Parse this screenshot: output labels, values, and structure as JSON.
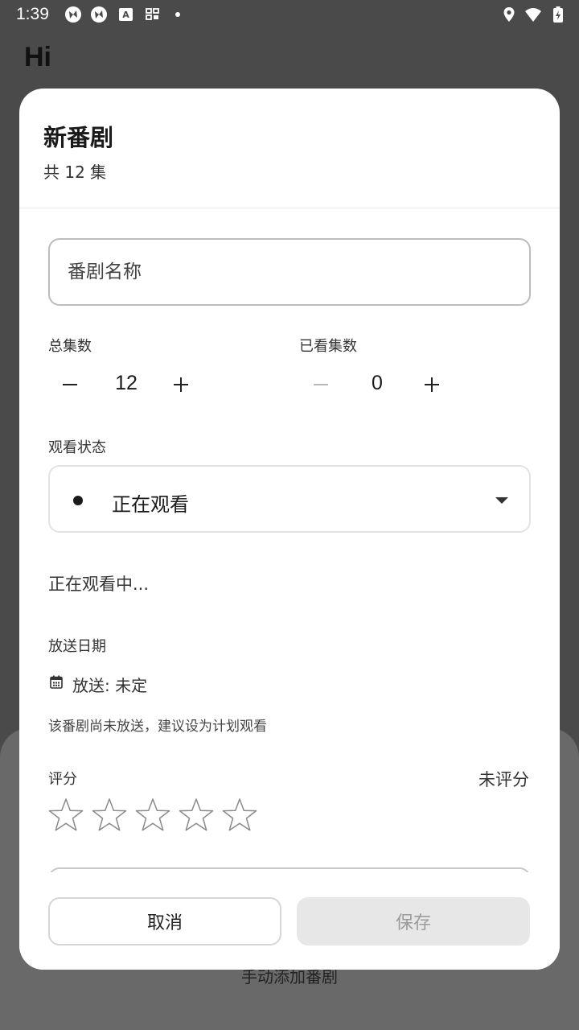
{
  "status_bar": {
    "time": "1:39",
    "left_icons": [
      "app-icon",
      "app-icon",
      "keyboard-icon",
      "screen-icon"
    ],
    "right_icons": [
      "location-icon",
      "wifi-icon",
      "battery-charging-icon"
    ]
  },
  "background": {
    "title": "Hi",
    "sheet_label": "手动添加番剧"
  },
  "dialog": {
    "title": "新番剧",
    "subtitle": "共 12 集",
    "name_placeholder": "番剧名称",
    "total_episodes": {
      "label": "总集数",
      "value": "12"
    },
    "watched_episodes": {
      "label": "已看集数",
      "value": "0"
    },
    "watch_status": {
      "label": "观看状态",
      "selected": "正在观看",
      "description": "正在观看中..."
    },
    "air_date": {
      "label": "放送日期",
      "value": "放送: 未定",
      "hint": "该番剧尚未放送，建议设为计划观看"
    },
    "rating": {
      "label": "评分",
      "value_text": "未评分",
      "stars_filled": 0,
      "stars_total": 5
    },
    "buttons": {
      "cancel": "取消",
      "save": "保存"
    }
  },
  "colors": {
    "scrim": "#4a4a4a",
    "dialog_bg": "#ffffff",
    "disabled_bg": "#e7e7e7",
    "disabled_text": "#9b9b9b"
  }
}
